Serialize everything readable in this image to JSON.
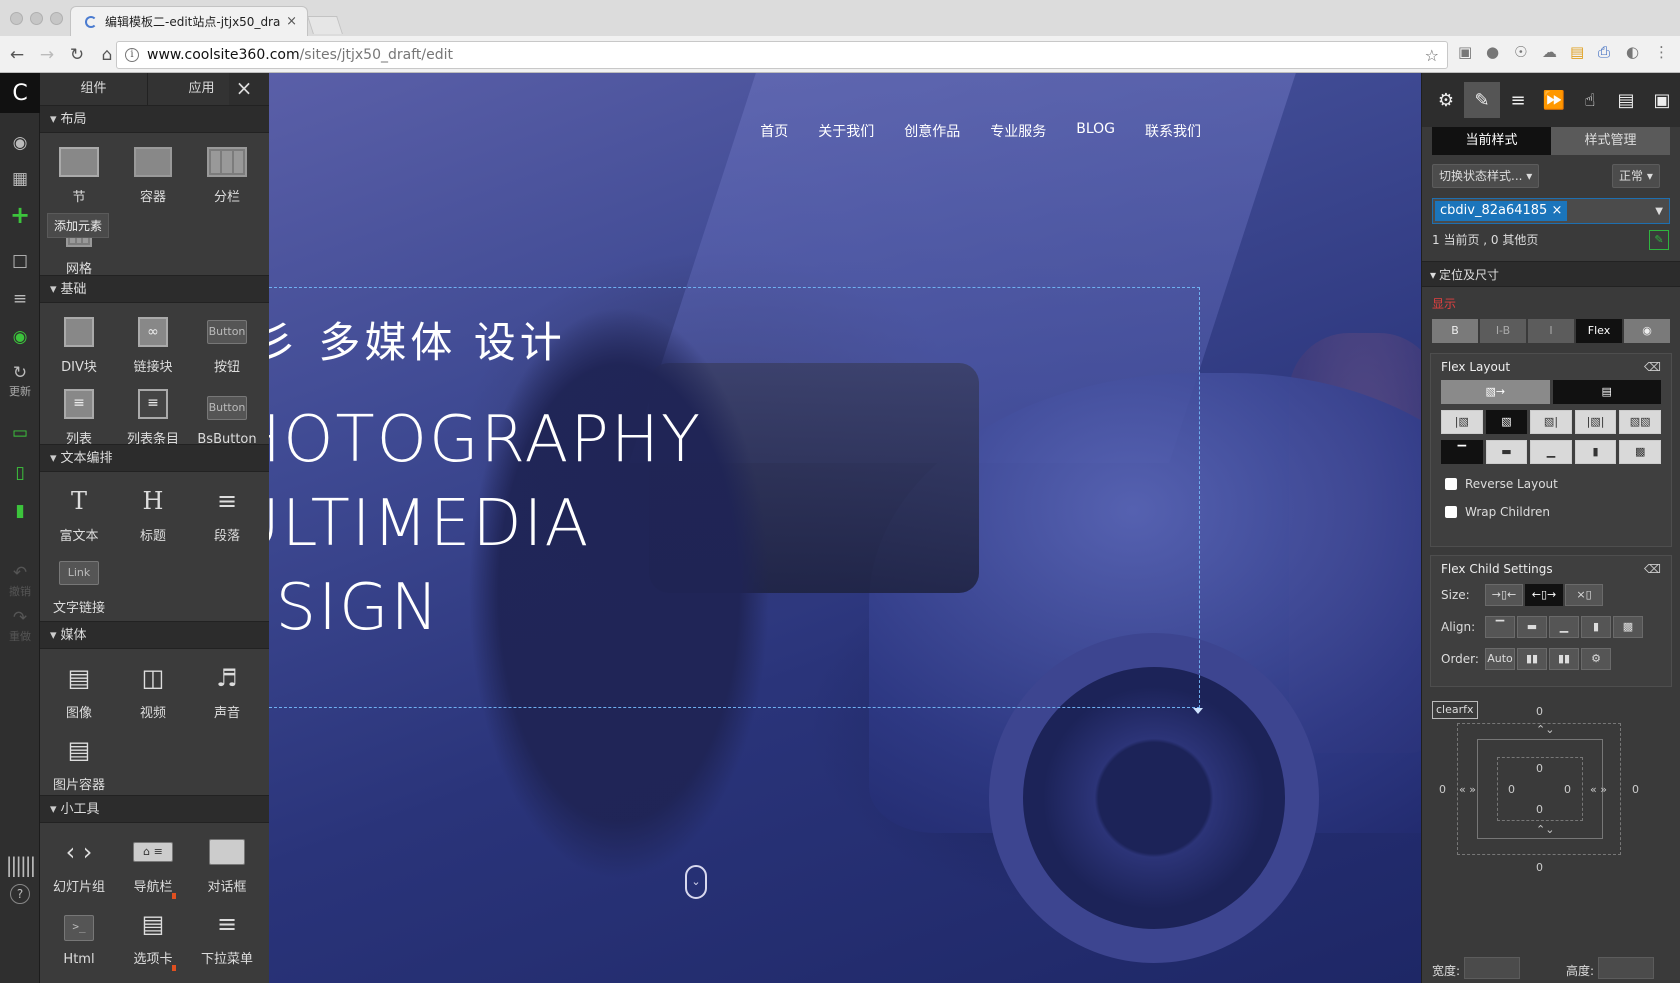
{
  "browser": {
    "tab_title": "编辑模板二-edit站点-jtjx50_dra",
    "tab_close": "×",
    "url_host": "www.coolsite360.com",
    "url_path": "/sites/jtjx50_draft/edit"
  },
  "left_toolbar": {
    "logo": "C",
    "tooltip": "添加元素",
    "update_label": "更新",
    "undo_label": "撤销",
    "redo_label": "重做",
    "help": "?"
  },
  "component_panel": {
    "tabs": [
      "组件",
      "应用"
    ],
    "close": "×",
    "sections": [
      {
        "title": "布局",
        "items": [
          "节",
          "容器",
          "分栏",
          "网格"
        ]
      },
      {
        "title": "基础",
        "items": [
          "DIV块",
          "链接块",
          "按钮",
          "列表",
          "列表条目",
          "BsButton"
        ]
      },
      {
        "title": "文本编排",
        "items": [
          "富文本",
          "标题",
          "段落",
          "文字链接"
        ]
      },
      {
        "title": "媒体",
        "items": [
          "图像",
          "视频",
          "声音",
          "图片容器"
        ]
      },
      {
        "title": "小工具",
        "items": [
          "幻灯片组",
          "导航栏",
          "对话框",
          "Html",
          "选项卡",
          "下拉菜单"
        ]
      }
    ],
    "button_text": "Button",
    "link_text": "Link"
  },
  "canvas": {
    "site_nav": [
      "首页",
      "关于我们",
      "创意作品",
      "专业服务",
      "BLOG",
      "联系我们"
    ],
    "cn_heading": "彡 多媒体 设计",
    "en_lines": [
      "HOTOGRAPHY",
      "ULTIMEDIA",
      "ESIGN"
    ]
  },
  "style_panel": {
    "tabs": [
      "当前样式",
      "样式管理"
    ],
    "state_dropdown": "切换状态样式...",
    "state_value": "正常",
    "class_chip": "cbdiv_82a64185",
    "page_count": "1 当前页 , 0 其他页",
    "section_title": "定位及尺寸",
    "display_label": "显示",
    "display_options": [
      "B",
      "I-B",
      "I",
      "Flex"
    ],
    "flex_layout_title": "Flex Layout",
    "reverse_label": "Reverse Layout",
    "wrap_label": "Wrap Children",
    "flex_child_title": "Flex Child Settings",
    "size_label": "Size:",
    "align_label": "Align:",
    "order_label": "Order:",
    "order_auto": "Auto",
    "clearfix": "clearfx",
    "margin_values": [
      "0",
      "0",
      "0",
      "0"
    ],
    "padding_values": [
      "0",
      "0",
      "0",
      "0"
    ],
    "width_label": "宽度:",
    "height_label": "高度:"
  }
}
